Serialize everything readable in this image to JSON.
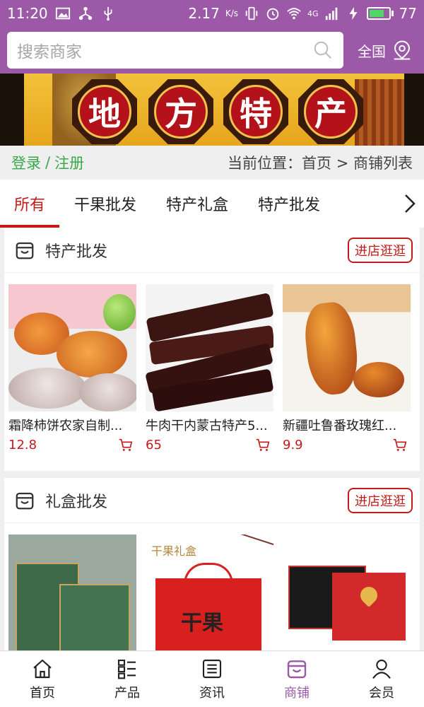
{
  "status_bar": {
    "time": "11:20",
    "speed": "2.17",
    "speed_unit": "K/s",
    "battery": "77",
    "battery_level": 0.77,
    "network_label": "4G"
  },
  "header": {
    "search_placeholder": "搜索商家",
    "region_label": "全国"
  },
  "banner": {
    "chars": [
      "地",
      "方",
      "特",
      "产"
    ]
  },
  "location_row": {
    "login": "登录",
    "separator": "/",
    "register": "注册",
    "position_text": "当前位置：首页 > 商铺列表"
  },
  "tabs": [
    {
      "label": "所有",
      "active": true
    },
    {
      "label": "干果批发",
      "active": false
    },
    {
      "label": "特产礼盒",
      "active": false
    },
    {
      "label": "特产批发",
      "active": false
    }
  ],
  "sections": [
    {
      "title": "特产批发",
      "button": "进店逛逛",
      "products": [
        {
          "title": "霜降柿饼农家自制...",
          "price": "12.8"
        },
        {
          "title": "牛肉干内蒙古特产5...",
          "price": "65"
        },
        {
          "title": "新疆吐鲁番玫瑰红...",
          "price": "9.9"
        }
      ]
    },
    {
      "title": "礼盒批发",
      "button": "进店逛逛",
      "products": [
        {
          "box_text": "",
          "title": "",
          "price": ""
        },
        {
          "box_text": "干果",
          "header_text": "干果礼盒",
          "title": "",
          "price": ""
        },
        {
          "box_text": "",
          "title": "",
          "price": ""
        }
      ]
    }
  ],
  "bottom_nav": [
    {
      "label": "首页",
      "icon": "home-icon",
      "active": false
    },
    {
      "label": "产品",
      "icon": "list-icon",
      "active": false
    },
    {
      "label": "资讯",
      "icon": "news-icon",
      "active": false
    },
    {
      "label": "商铺",
      "icon": "shop-icon",
      "active": true
    },
    {
      "label": "会员",
      "icon": "user-icon",
      "active": false
    }
  ],
  "colors": {
    "brand": "#9b59a8",
    "accent_red": "#c41a1a",
    "link_green": "#3aa84b"
  }
}
